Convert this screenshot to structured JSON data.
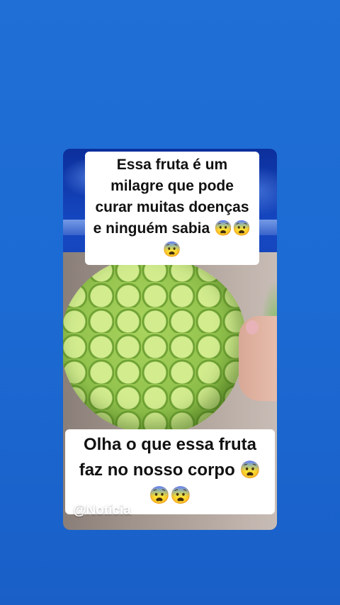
{
  "post": {
    "caption_top": {
      "line1": "Essa fruta é um",
      "line2": "milagre que pode",
      "line3": "curar muitas doenças",
      "line4": "e ninguém sabia 😨😨",
      "line5": "😨"
    },
    "caption_bottom": {
      "line1": "Olha o que essa fruta",
      "line2": "faz no nosso corpo 😨",
      "line3": "😨😨"
    },
    "watermark": "@Notícia"
  },
  "colors": {
    "background": "#1c6ad3",
    "card": "#1648c2",
    "caption_bg": "#ffffff",
    "caption_text": "#111111"
  }
}
